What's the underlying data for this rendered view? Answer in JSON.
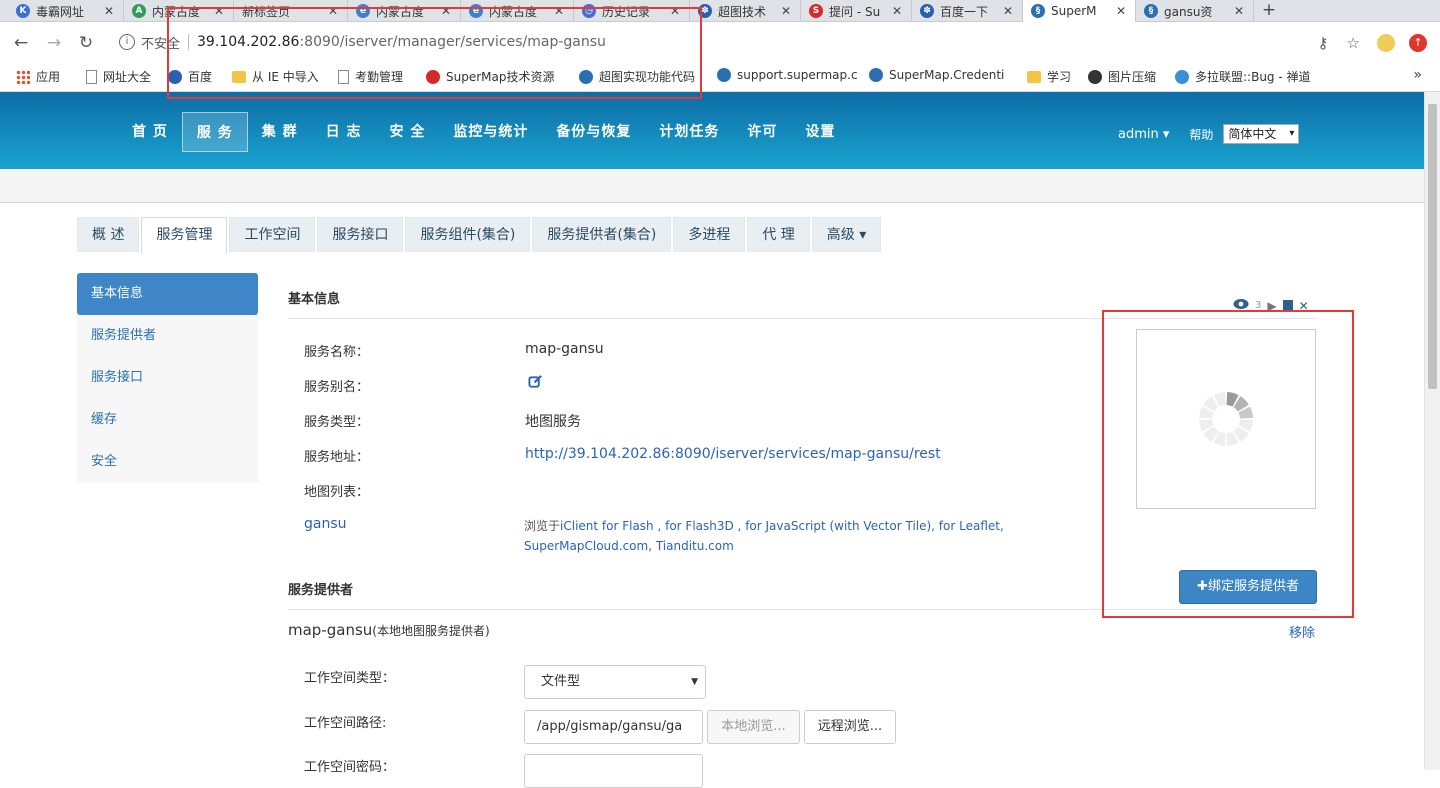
{
  "browser": {
    "tabs": [
      {
        "title": "毒霸网址",
        "icon_color": "#3b6fd6",
        "icon_glyph": "K"
      },
      {
        "title": "内蒙古度",
        "icon_color": "#2e9d57",
        "icon_glyph": "A"
      },
      {
        "title": "新标签页",
        "icon_color": "",
        "icon_glyph": ""
      },
      {
        "title": "内蒙古度",
        "icon_color": "#3d7fd3",
        "icon_glyph": "e"
      },
      {
        "title": "内蒙古度",
        "icon_color": "#3d7fd3",
        "icon_glyph": "e"
      },
      {
        "title": "历史记录",
        "icon_color": "#4a6cd4",
        "icon_glyph": "◷"
      },
      {
        "title": "超图技术",
        "icon_color": "#2b5fb3",
        "icon_glyph": "✽"
      },
      {
        "title": "提问 - Su",
        "icon_color": "#d42a2a",
        "icon_glyph": "S"
      },
      {
        "title": "百度一下",
        "icon_color": "#2b5fb3",
        "icon_glyph": "✽"
      },
      {
        "title": "SuperM",
        "icon_color": "#2a6fb0",
        "icon_glyph": "§"
      },
      {
        "title": "gansu资",
        "icon_color": "#2a6fb0",
        "icon_glyph": "§"
      }
    ],
    "tab_close": "✕",
    "new_tab": "+",
    "insecure_label": "不安全",
    "url_host": "39.104.202.86",
    "url_rest": ":8090/iserver/manager/services/map-gansu",
    "bookmarks": [
      {
        "label": "应用",
        "icon": "apps-icon",
        "color": "#d65a31"
      },
      {
        "label": "网址大全",
        "icon": "page-icon",
        "color": "#888888"
      },
      {
        "label": "百度",
        "icon": "baidu-icon",
        "color": "#2b5fb3"
      },
      {
        "label": "从 IE 中导入",
        "icon": "folder-icon",
        "color": "#f4c542"
      },
      {
        "label": "考勤管理",
        "icon": "page-icon",
        "color": "#888888"
      },
      {
        "label": "SuperMap技术资源",
        "icon": "supermap-s-icon",
        "color": "#d42a2a"
      },
      {
        "label": "超图实现功能代码",
        "icon": "supermap-icon",
        "color": "#2a6fb0"
      },
      {
        "label": "support.supermap.c",
        "icon": "supermap-icon",
        "color": "#2a6fb0"
      },
      {
        "label": "SuperMap.Credenti",
        "icon": "supermap-icon",
        "color": "#2a6fb0"
      },
      {
        "label": "学习",
        "icon": "folder-icon",
        "color": "#f4c542"
      },
      {
        "label": "图片压缩",
        "icon": "panda-icon",
        "color": "#333333"
      },
      {
        "label": "多拉联盟::Bug - 禅道",
        "icon": "globe-icon",
        "color": "#3a8fd6"
      }
    ],
    "bookmarks_more": "»"
  },
  "header": {
    "nav": [
      "首 页",
      "服 务",
      "集 群",
      "日 志",
      "安 全",
      "监控与统计",
      "备份与恢复",
      "计划任务",
      "许可",
      "设置"
    ],
    "active_index": 1,
    "user": "admin",
    "user_caret": "▾",
    "help": "帮助",
    "language": "简体中文",
    "language_caret": "▾"
  },
  "subtabs": {
    "items": [
      "概 述",
      "服务管理",
      "工作空间",
      "服务接口",
      "服务组件(集合)",
      "服务提供者(集合)",
      "多进程",
      "代 理",
      "高级 ▾"
    ],
    "active_index": 1
  },
  "sidemenu": {
    "items": [
      "基本信息",
      "服务提供者",
      "服务接口",
      "缓存",
      "安全"
    ],
    "active_index": 0
  },
  "basic": {
    "title": "基本信息",
    "view_count": "3",
    "fields": [
      {
        "label": "服务名称：",
        "value": "map-gansu"
      },
      {
        "label": "服务别名：",
        "value": ""
      },
      {
        "label": "服务类型：",
        "value": "地图服务"
      },
      {
        "label": "服务地址：",
        "value": "http://39.104.202.86:8090/iserver/services/map-gansu/rest"
      },
      {
        "label": "地图列表：",
        "value": ""
      }
    ],
    "map_name": "gansu",
    "browse_prefix": "浏览于",
    "browse_links": "iClient for Flash , for Flash3D , for JavaScript (with Vector Tile), for Leaflet, SuperMapCloud.com, Tianditu.com"
  },
  "provider": {
    "title": "服务提供者",
    "bind_button": "✚绑定服务提供者",
    "name": "map-gansu",
    "name_note": "(本地地图服务提供者)",
    "remove": "移除",
    "ws_type_label": "工作空间类型：",
    "ws_type_value": "文件型",
    "ws_path_label": "工作空间路径:",
    "ws_path_value": "/app/gismap/gansu/ga",
    "local_browse": "本地浏览...",
    "remote_browse": "远程浏览...",
    "ws_pwd_label": "工作空间密码："
  },
  "colors": {
    "accent": "#3d86c6",
    "link": "#2a64b5",
    "header_top": "#0d6da6",
    "header_bottom": "#1aa3d0",
    "annotation": "#e53935"
  }
}
